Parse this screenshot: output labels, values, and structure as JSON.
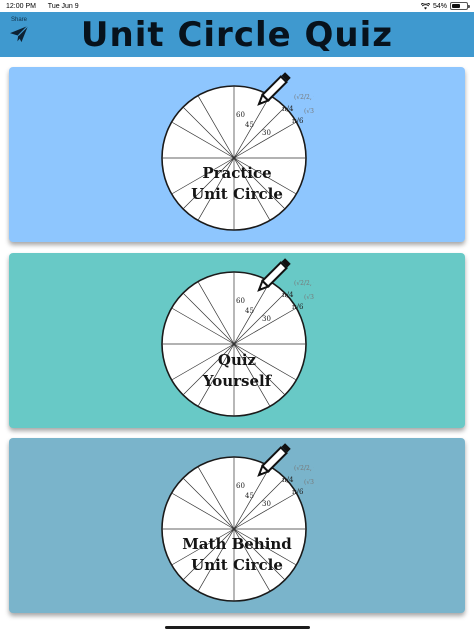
{
  "status_bar": {
    "time": "12:00 PM",
    "date": "Tue Jun 9",
    "battery": "54%",
    "battery_level": 0.54
  },
  "header": {
    "title": "Unit Circle Quiz",
    "share_label": "Share",
    "background": "#3f99cf"
  },
  "diagram_labels": {
    "angle_60": "60",
    "angle_45": "45",
    "angle_30": "30",
    "frac_pi_4": "π/4",
    "frac_pi_6": "π/6",
    "coord_1": "(√2/2, √2/2)",
    "coord_2": "(√3/2, 1/2)"
  },
  "cards": [
    {
      "lines": [
        "Practice",
        "Unit Circle"
      ],
      "background": "#8ec6fe"
    },
    {
      "lines": [
        "Quiz",
        "Yourself"
      ],
      "background": "#68c9c6"
    },
    {
      "lines": [
        "Math Behind",
        "Unit Circle"
      ],
      "background": "#7ab4cb"
    }
  ]
}
